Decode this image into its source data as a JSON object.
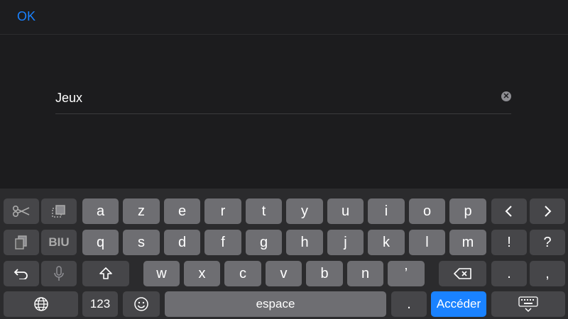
{
  "header": {
    "ok_label": "OK"
  },
  "search": {
    "value": "Jeux"
  },
  "keyboard": {
    "row1": [
      "a",
      "z",
      "e",
      "r",
      "t",
      "y",
      "u",
      "i",
      "o",
      "p"
    ],
    "row2": [
      "q",
      "s",
      "d",
      "f",
      "g",
      "h",
      "j",
      "k",
      "l",
      "m"
    ],
    "row3": [
      "w",
      "x",
      "c",
      "v",
      "b",
      "n",
      "’"
    ],
    "format_label": "BIU",
    "punct": {
      "excl": "!",
      "quest": "?",
      "period": ".",
      "comma": ",",
      "period2": "."
    },
    "numbers_label": "123",
    "space_label": "espace",
    "go_label": "Accéder"
  },
  "icons": {
    "cut": "scissors-icon",
    "copy": "copy-icon",
    "paste": "paste-icon",
    "undo": "undo-icon",
    "mic": "microphone-icon",
    "shift": "shift-icon",
    "backspace": "backspace-icon",
    "globe": "globe-icon",
    "emoji": "emoji-icon",
    "hide": "keyboard-hide-icon",
    "left": "arrow-left-icon",
    "right": "arrow-right-icon"
  },
  "colors": {
    "accent": "#1a82ff",
    "background": "#1c1c1e",
    "key_light": "#6e6e72",
    "key_dark": "#464649"
  }
}
